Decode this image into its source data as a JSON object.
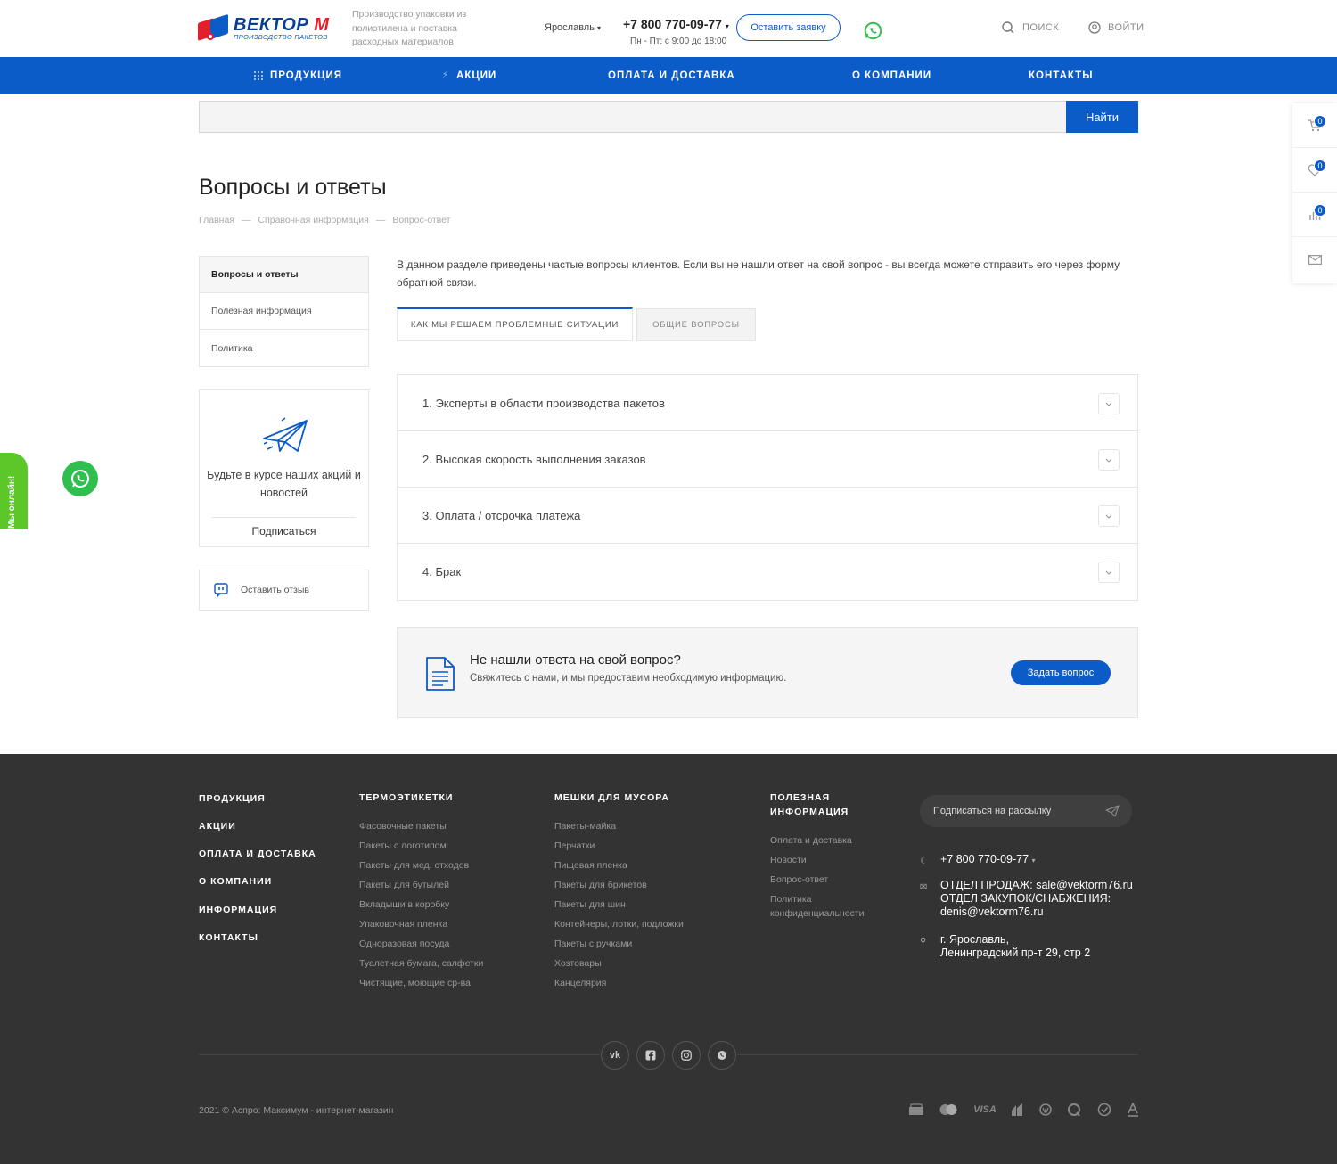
{
  "header": {
    "logo_name": "ВЕКТОР",
    "logo_m": "М",
    "logo_sub": "ПРОИЗВОДСТВО ПАКЕТОВ",
    "tagline": "Производство упаковки из полиэтилена и поставка расходных материалов",
    "city": "Ярославль",
    "phone": "+7 800 770-09-77",
    "hours": "Пн - Пт: с 9:00 до 18:00",
    "request_button": "Оставить заявку",
    "search_label": "ПОИСК",
    "login_label": "ВОЙТИ"
  },
  "nav": {
    "items": [
      "ПРОДУКЦИЯ",
      "АКЦИИ",
      "ОПЛАТА И ДОСТАВКА",
      "О КОМПАНИИ",
      "КОНТАКТЫ"
    ]
  },
  "search": {
    "placeholder": "",
    "button": "Найти"
  },
  "side_panel": {
    "cart_count": "0",
    "favorites_count": "0",
    "compare_count": "0"
  },
  "page": {
    "title": "Вопросы и ответы",
    "breadcrumb": [
      "Главная",
      "—",
      "Справочная информация",
      "—",
      "Вопрос-ответ"
    ]
  },
  "left_menu": {
    "items": [
      "Вопросы и ответы",
      "Полезная информация",
      "Политика"
    ]
  },
  "subscribe": {
    "text": "Будьте в курсе наших акций и новостей",
    "link": "Подписаться"
  },
  "review": {
    "label": "Оставить отзыв"
  },
  "main": {
    "intro": "В данном разделе приведены частые вопросы клиентов. Если вы не нашли ответ на свой вопрос - вы всегда можете отправить его через форму обратной связи.",
    "tabs": [
      "КАК МЫ РЕШАЕМ ПРОБЛЕМНЫЕ СИТУАЦИИ",
      "ОБЩИЕ ВОПРОСЫ"
    ],
    "faq": [
      "1. Эксперты в области производства пакетов",
      "2. Высокая скорость выполнения заказов",
      "3. Оплата / отсрочка платежа",
      "4. Брак"
    ],
    "no_answer": {
      "title": "Не нашли ответа на свой вопрос?",
      "subtitle": "Свяжитесь с нами, и мы предоставим необходимую информацию.",
      "button": "Задать вопрос"
    }
  },
  "green_tab": {
    "label": "Мы онлайн!"
  },
  "footer": {
    "main_links": [
      "ПРОДУКЦИЯ",
      "АКЦИИ",
      "ОПЛАТА И ДОСТАВКА",
      "О КОМПАНИИ",
      "ИНФОРМАЦИЯ",
      "КОНТАКТЫ"
    ],
    "col1": {
      "title": "ТЕРМОЭТИКЕТКИ",
      "links": [
        "Фасовочные пакеты",
        "Пакеты с логотипом",
        "Пакеты для мед. отходов",
        "Пакеты для бутылей",
        "Вкладыши в коробку",
        "Упаковочная пленка",
        "Одноразовая посуда",
        "Туалетная бумага, салфетки",
        "Чистящие, моющие ср-ва"
      ]
    },
    "col2": {
      "title": "МЕШКИ ДЛЯ МУСОРА",
      "links": [
        "Пакеты-майка",
        "Перчатки",
        "Пищевая пленка",
        "Пакеты для брикетов",
        "Пакеты для шин",
        "Контейнеры, лотки, подложки",
        "Пакеты с ручками",
        "Хозтовары",
        "Канцелярия"
      ]
    },
    "col3": {
      "title_1": "ПОЛЕЗНАЯ",
      "title_2": "ИНФОРМАЦИЯ",
      "links": [
        "Оплата и доставка",
        "Новости",
        "Вопрос-ответ",
        "Политика конфиденциальности"
      ]
    },
    "newsletter": "Подписаться на рассылку",
    "phone": "+7 800 770-09-77",
    "email_1": "ОТДЕЛ ПРОДАЖ: sale@vektorm76.ru",
    "email_2": "ОТДЕЛ ЗАКУПОК/СНАБЖЕНИЯ:",
    "email_3": "denis@vektorm76.ru",
    "address_1": "г. Ярославль,",
    "address_2": "Ленинградский пр-т 29, стр 2",
    "social": [
      "vk-icon",
      "facebook-icon",
      "instagram-icon",
      "whatsapp-icon"
    ],
    "copyright": "2021 © Аспро: Максимум - интернет-магазин",
    "payments": [
      "cash-icon",
      "mastercard-icon",
      "VISA",
      "sberbank-icon",
      "webmoney-icon",
      "qiwi-icon",
      "yandex-money-icon",
      "alfa-icon"
    ]
  },
  "colors": {
    "brand_blue": "#0b5cc9",
    "brand_red": "#e41e2b",
    "footer_bg": "#333333",
    "whatsapp_green": "#2fbf4f"
  }
}
